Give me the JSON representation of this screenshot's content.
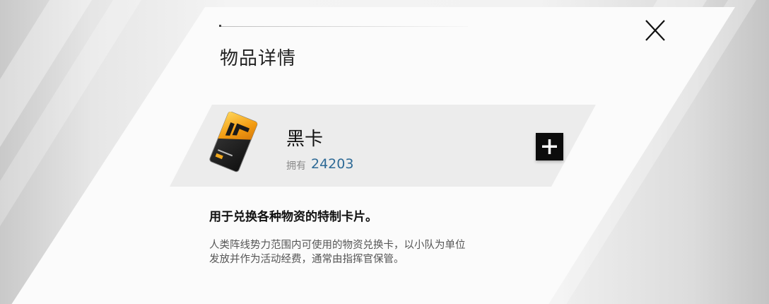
{
  "dialog": {
    "title": "物品详情"
  },
  "item": {
    "name": "黑卡",
    "owned_label": "拥有",
    "owned_count": "24203",
    "image_icon": "black-card-icon"
  },
  "summary": "用于兑换各种物资的特制卡片。",
  "description_lines": [
    "人类阵线势力范围内可使用的物资兑换卡，以小队为单位",
    "发放并作为活动经费，通常由指挥官保管。"
  ],
  "icons": {
    "close": "close-icon",
    "add": "plus-icon"
  },
  "colors": {
    "count": "#2e6a96",
    "card_gold": "#f2a81c",
    "button_bg": "#0c0c0c"
  }
}
